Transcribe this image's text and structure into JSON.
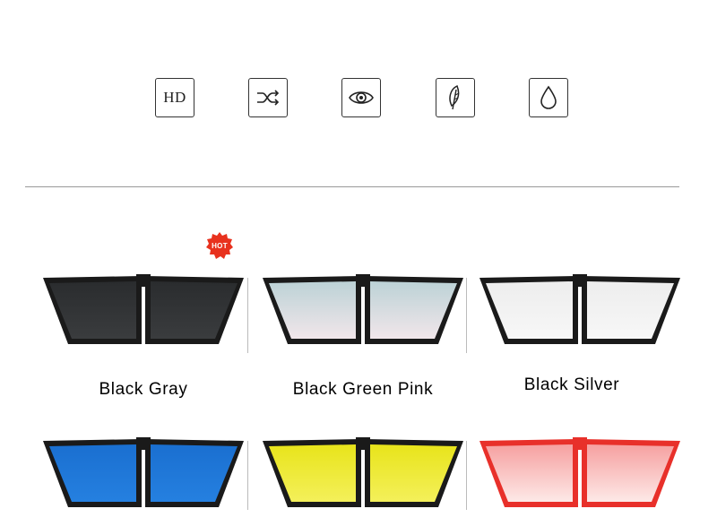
{
  "features": [
    {
      "icon": "hd-icon",
      "text": "HD"
    },
    {
      "icon": "shuffle-icon"
    },
    {
      "icon": "eye-icon"
    },
    {
      "icon": "feather-icon"
    },
    {
      "icon": "water-drop-icon"
    }
  ],
  "badge": {
    "text": "HOT",
    "color": "#e8321e"
  },
  "products": [
    {
      "label": "Black Gray",
      "frame": "#1a1a1a",
      "lens_top": "#2a2c2e",
      "lens_bottom": "#3a3c3e"
    },
    {
      "label": "Black Green Pink",
      "frame": "#1a1a1a",
      "lens_top": "#bcd2d6",
      "lens_bottom": "#f1e6ea"
    },
    {
      "label": "Black Silver",
      "frame": "#1a1a1a",
      "lens_top": "#ededed",
      "lens_bottom": "#f7f7f7"
    },
    {
      "frame": "#1a1a1a",
      "lens_top": "#1a6fd0",
      "lens_bottom": "#2580e0"
    },
    {
      "frame": "#1a1a1a",
      "lens_top": "#e8e41a",
      "lens_bottom": "#f4f05a"
    },
    {
      "frame": "#e8302a",
      "lens_top": "#f6a0a0",
      "lens_bottom": "#fde9e7"
    }
  ]
}
